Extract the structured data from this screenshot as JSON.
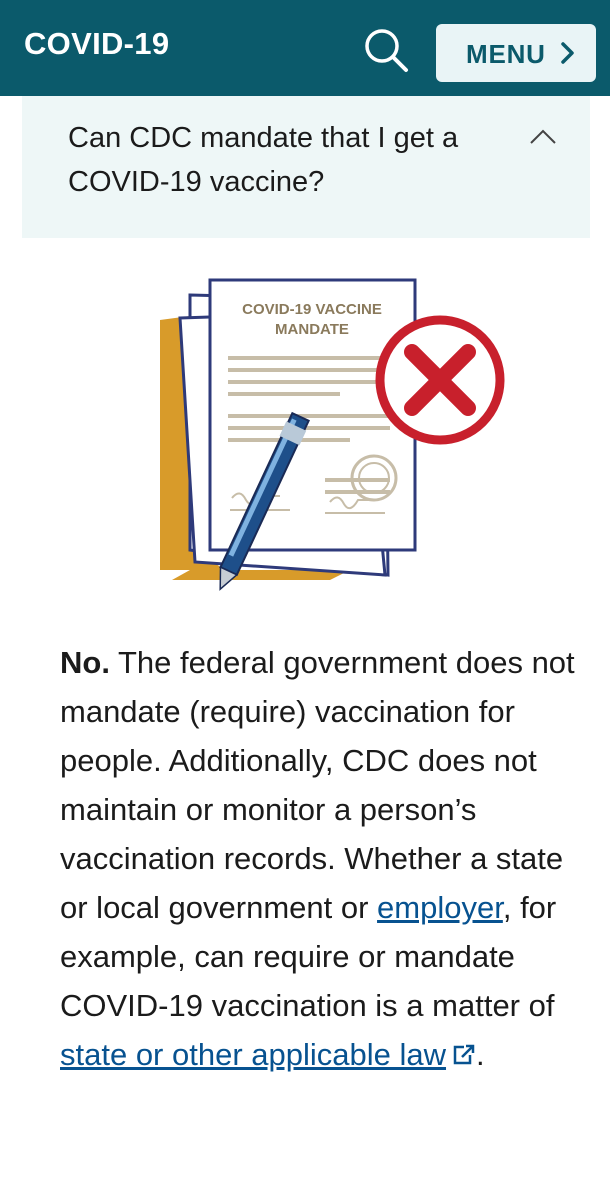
{
  "header": {
    "title": "COVID-19",
    "menu_label": "MENU",
    "icons": {
      "search": "search-icon",
      "menu": "chevron-right-icon"
    },
    "colors": {
      "background": "#0b5a6b",
      "menu_background": "#e9f4f6"
    }
  },
  "accordion": {
    "question": "Can CDC mandate that I get a COVID-19 vaccine?",
    "state": "expanded",
    "icon": "chevron-up-icon"
  },
  "illustration": {
    "document_title_line1": "COVID-19 VACCINE",
    "document_title_line2": "MANDATE"
  },
  "answer": {
    "lead": "No.",
    "text_1": " The federal government does not mandate (require) vaccination for people. Additionally, CDC does not maintain or monitor a person’s vaccination records. Whether a state or local government or ",
    "link_employer": "employer",
    "text_2": ", for example, can require or mandate COVID-19 vaccination is a matter of ",
    "link_law": "state or other applicable law",
    "text_end": ".",
    "link_color": "#075290",
    "external_icon": "external-link-icon"
  }
}
